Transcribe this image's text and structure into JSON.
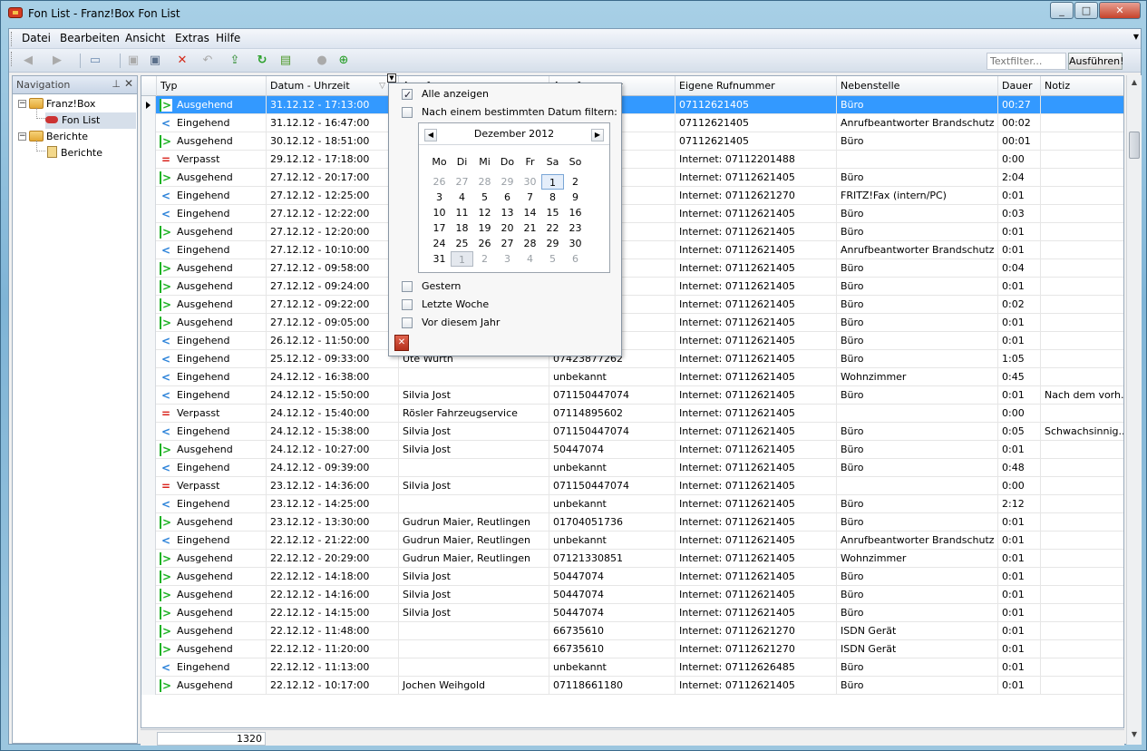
{
  "window": {
    "title": "Fon List - Franz!Box Fon List"
  },
  "menu": [
    "Datei",
    "Bearbeiten",
    "Ansicht",
    "Extras",
    "Hilfe"
  ],
  "toolbar": {
    "filter_placeholder": "Textfilter...",
    "run_label": "Ausführen!"
  },
  "nav": {
    "title": "Navigation",
    "tree": [
      {
        "label": "Franz!Box",
        "level": 0,
        "icon": "folder-open-icon"
      },
      {
        "label": "Fon List",
        "level": 1,
        "icon": "phone-icon",
        "selected": true
      },
      {
        "label": "Berichte",
        "level": 0,
        "icon": "folder-open-icon"
      },
      {
        "label": "Berichte",
        "level": 1,
        "icon": "report-icon"
      }
    ]
  },
  "grid": {
    "columns": [
      "Typ",
      "Datum - Uhrzeit",
      "Anrufer",
      "Anrufnummer",
      "Eigene Rufnummer",
      "Nebenstelle",
      "Dauer",
      "Notiz"
    ],
    "rows": [
      [
        "Ausgehend",
        "31.12.12 - 17:13:00",
        "",
        "",
        "07112621405",
        "Büro",
        "00:27",
        ""
      ],
      [
        "Eingehend",
        "31.12.12 - 16:47:00",
        "",
        "",
        "07112621405",
        "Anrufbeantworter Brandschutz",
        "00:02",
        ""
      ],
      [
        "Ausgehend",
        "30.12.12 - 18:51:00",
        "",
        "",
        "07112621405",
        "Büro",
        "00:01",
        ""
      ],
      [
        "Verpasst",
        "29.12.12 - 17:18:00",
        "",
        "",
        "Internet: 07112201488",
        "",
        "0:00",
        ""
      ],
      [
        "Ausgehend",
        "27.12.12 - 20:17:00",
        "",
        "",
        "Internet: 07112621405",
        "Büro",
        "2:04",
        ""
      ],
      [
        "Eingehend",
        "27.12.12 - 12:25:00",
        "",
        "",
        "Internet: 07112621270",
        "FRITZ!Fax (intern/PC)",
        "0:01",
        ""
      ],
      [
        "Eingehend",
        "27.12.12 - 12:22:00",
        "",
        "",
        "Internet: 07112621405",
        "Büro",
        "0:03",
        ""
      ],
      [
        "Ausgehend",
        "27.12.12 - 12:20:00",
        "",
        "",
        "Internet: 07112621405",
        "Büro",
        "0:01",
        ""
      ],
      [
        "Eingehend",
        "27.12.12 - 10:10:00",
        "",
        "",
        "Internet: 07112621405",
        "Anrufbeantworter Brandschutz",
        "0:01",
        ""
      ],
      [
        "Ausgehend",
        "27.12.12 - 09:58:00",
        "",
        "",
        "Internet: 07112621405",
        "Büro",
        "0:04",
        ""
      ],
      [
        "Ausgehend",
        "27.12.12 - 09:24:00",
        "",
        "",
        "Internet: 07112621405",
        "Büro",
        "0:01",
        ""
      ],
      [
        "Ausgehend",
        "27.12.12 - 09:22:00",
        "",
        "",
        "Internet: 07112621405",
        "Büro",
        "0:02",
        ""
      ],
      [
        "Ausgehend",
        "27.12.12 - 09:05:00",
        "",
        "",
        "Internet: 07112621405",
        "Büro",
        "0:01",
        ""
      ],
      [
        "Eingehend",
        "26.12.12 - 11:50:00",
        "",
        "",
        "Internet: 07112621405",
        "Büro",
        "0:01",
        ""
      ],
      [
        "Eingehend",
        "25.12.12 - 09:33:00",
        "Ute Würth",
        "07423877262",
        "Internet: 07112621405",
        "Büro",
        "1:05",
        ""
      ],
      [
        "Eingehend",
        "24.12.12 - 16:38:00",
        "",
        "unbekannt",
        "Internet: 07112621405",
        "Wohnzimmer",
        "0:45",
        ""
      ],
      [
        "Eingehend",
        "24.12.12 - 15:50:00",
        "Silvia Jost",
        "071150447074",
        "Internet: 07112621405",
        "Büro",
        "0:01",
        "Nach dem vorh..."
      ],
      [
        "Verpasst",
        "24.12.12 - 15:40:00",
        "Rösler Fahrzeugservice",
        "07114895602",
        "Internet: 07112621405",
        "",
        "0:00",
        ""
      ],
      [
        "Eingehend",
        "24.12.12 - 15:38:00",
        "Silvia Jost",
        "071150447074",
        "Internet: 07112621405",
        "Büro",
        "0:05",
        "Schwachsinnig..."
      ],
      [
        "Ausgehend",
        "24.12.12 - 10:27:00",
        "Silvia Jost",
        "50447074",
        "Internet: 07112621405",
        "Büro",
        "0:01",
        ""
      ],
      [
        "Eingehend",
        "24.12.12 - 09:39:00",
        "",
        "unbekannt",
        "Internet: 07112621405",
        "Büro",
        "0:48",
        ""
      ],
      [
        "Verpasst",
        "23.12.12 - 14:36:00",
        "Silvia Jost",
        "071150447074",
        "Internet: 07112621405",
        "",
        "0:00",
        ""
      ],
      [
        "Eingehend",
        "23.12.12 - 14:25:00",
        "",
        "unbekannt",
        "Internet: 07112621405",
        "Büro",
        "2:12",
        ""
      ],
      [
        "Ausgehend",
        "23.12.12 - 13:30:00",
        "Gudrun Maier, Reutlingen",
        "01704051736",
        "Internet: 07112621405",
        "Büro",
        "0:01",
        ""
      ],
      [
        "Eingehend",
        "22.12.12 - 21:22:00",
        "Gudrun Maier, Reutlingen",
        "unbekannt",
        "Internet: 07112621405",
        "Anrufbeantworter Brandschutz",
        "0:01",
        ""
      ],
      [
        "Ausgehend",
        "22.12.12 - 20:29:00",
        "Gudrun Maier, Reutlingen",
        "07121330851",
        "Internet: 07112621405",
        "Wohnzimmer",
        "0:01",
        ""
      ],
      [
        "Ausgehend",
        "22.12.12 - 14:18:00",
        "Silvia Jost",
        "50447074",
        "Internet: 07112621405",
        "Büro",
        "0:01",
        ""
      ],
      [
        "Ausgehend",
        "22.12.12 - 14:16:00",
        "Silvia Jost",
        "50447074",
        "Internet: 07112621405",
        "Büro",
        "0:01",
        ""
      ],
      [
        "Ausgehend",
        "22.12.12 - 14:15:00",
        "Silvia Jost",
        "50447074",
        "Internet: 07112621405",
        "Büro",
        "0:01",
        ""
      ],
      [
        "Ausgehend",
        "22.12.12 - 11:48:00",
        "",
        "66735610",
        "Internet: 07112621270",
        "ISDN Gerät",
        "0:01",
        ""
      ],
      [
        "Ausgehend",
        "22.12.12 - 11:20:00",
        "",
        "66735610",
        "Internet: 07112621270",
        "ISDN Gerät",
        "0:01",
        ""
      ],
      [
        "Eingehend",
        "22.12.12 - 11:13:00",
        "",
        "unbekannt",
        "Internet: 07112626485",
        "Büro",
        "0:01",
        ""
      ],
      [
        "Ausgehend",
        "22.12.12 - 10:17:00",
        "Jochen Weihgold",
        "07118661180",
        "Internet: 07112621405",
        "Büro",
        "0:01",
        ""
      ]
    ],
    "count": "1320"
  },
  "date_filter": {
    "opt_all": "Alle anzeigen",
    "opt_date": "Nach einem bestimmten Datum filtern:",
    "month": "Dezember 2012",
    "weekdays": [
      "Mo",
      "Di",
      "Mi",
      "Do",
      "Fr",
      "Sa",
      "So"
    ],
    "days": [
      [
        "26",
        "27",
        "28",
        "29",
        "30",
        "1",
        "2"
      ],
      [
        "3",
        "4",
        "5",
        "6",
        "7",
        "8",
        "9"
      ],
      [
        "10",
        "11",
        "12",
        "13",
        "14",
        "15",
        "16"
      ],
      [
        "17",
        "18",
        "19",
        "20",
        "21",
        "22",
        "23"
      ],
      [
        "24",
        "25",
        "26",
        "27",
        "28",
        "29",
        "30"
      ],
      [
        "31",
        "1",
        "2",
        "3",
        "4",
        "5",
        "6"
      ]
    ],
    "opt_yesterday": "Gestern",
    "opt_lastweek": "Letzte Woche",
    "opt_beforeyear": "Vor diesem Jahr"
  },
  "colors": {
    "outgoing": "#1db223",
    "incoming": "#2b82d9",
    "missed": "#d9231c",
    "selection": "#3399ff"
  }
}
